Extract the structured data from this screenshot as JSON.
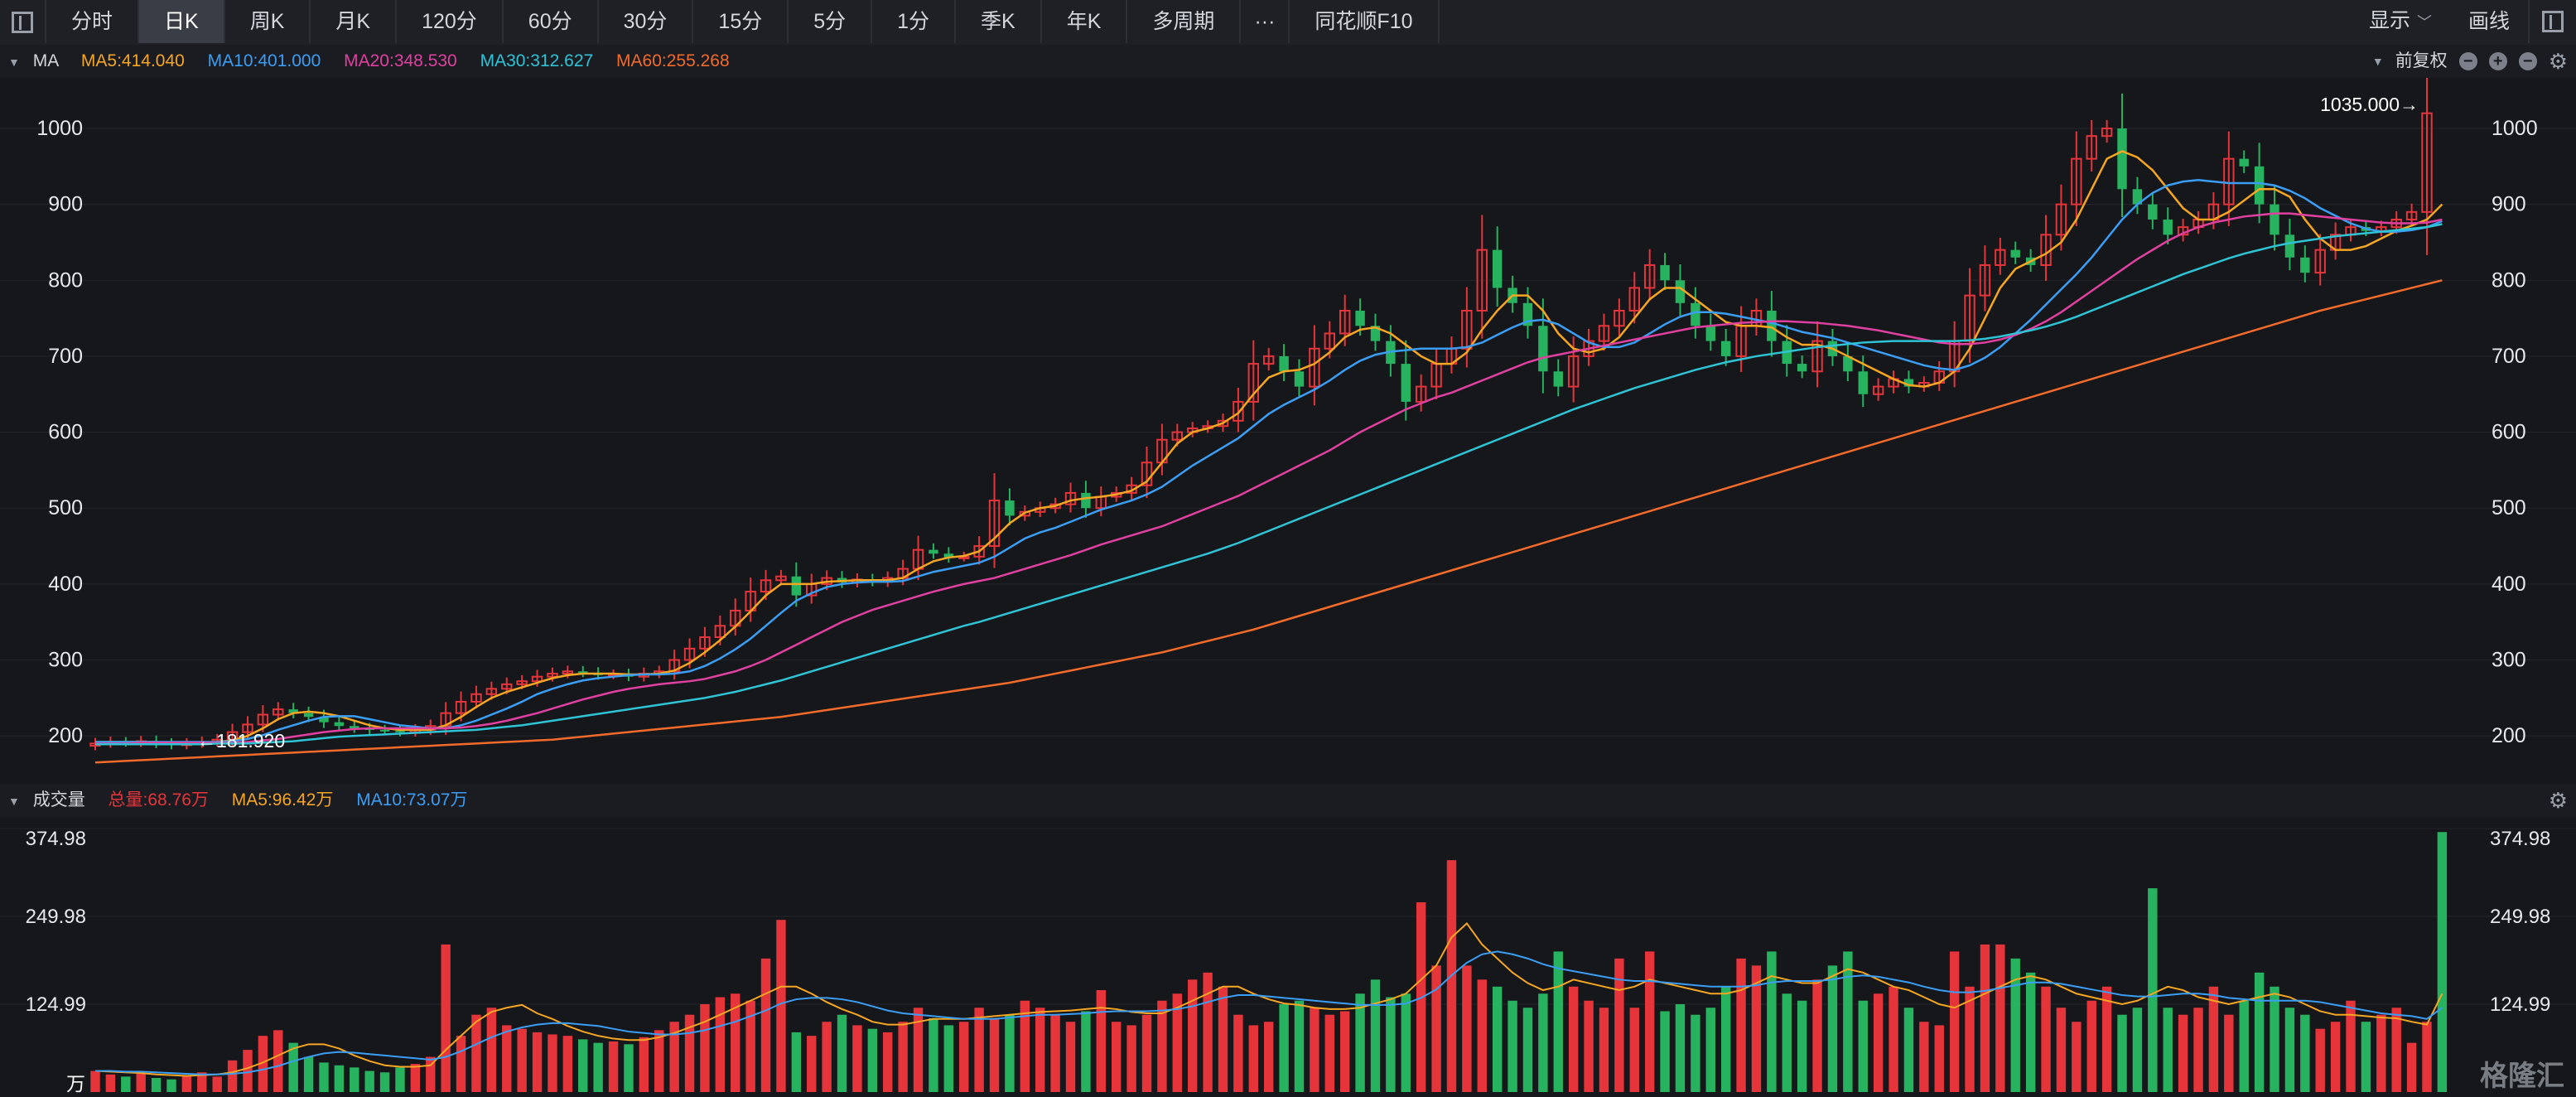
{
  "toolbar": {
    "tabs": [
      "分时",
      "日K",
      "周K",
      "月K",
      "120分",
      "60分",
      "30分",
      "15分",
      "5分",
      "1分",
      "季K",
      "年K",
      "多周期"
    ],
    "more": "···",
    "f10": "同花顺F10",
    "display": "显示",
    "draw": "画线"
  },
  "price_panel": {
    "label": "MA",
    "ma": [
      {
        "text": "MA5:414.040",
        "color": "#f5a623"
      },
      {
        "text": "MA10:401.000",
        "color": "#3b9ef5"
      },
      {
        "text": "MA20:348.530",
        "color": "#e040a0"
      },
      {
        "text": "MA30:312.627",
        "color": "#2ec4d6"
      },
      {
        "text": "MA60:255.268",
        "color": "#f26b2a"
      }
    ],
    "adjust": "前复权",
    "high_label": "1035.000→",
    "low_label": "←181.920"
  },
  "volume_panel": {
    "label": "成交量",
    "items": [
      {
        "text": "总量:68.76万",
        "color": "#e5353b"
      },
      {
        "text": "MA5:96.42万",
        "color": "#f5a623"
      },
      {
        "text": "MA10:73.07万",
        "color": "#3b9ef5"
      }
    ],
    "unit": "万"
  },
  "watermark": "格隆汇",
  "colors": {
    "up": "#e5353b",
    "down": "#27b25f",
    "bg": "#16171b"
  },
  "chart_data": [
    {
      "type": "candlestick",
      "y_ticks": [
        200,
        300,
        400,
        500,
        600,
        700,
        800,
        900,
        1000
      ],
      "ylim": [
        150,
        1060
      ],
      "close": [
        190,
        192,
        191,
        193,
        190,
        188,
        190,
        192,
        195,
        205,
        215,
        228,
        235,
        230,
        225,
        218,
        213,
        210,
        208,
        207,
        205,
        208,
        213,
        230,
        245,
        255,
        262,
        268,
        272,
        278,
        282,
        285,
        283,
        280,
        281,
        278,
        282,
        285,
        300,
        315,
        330,
        345,
        365,
        390,
        405,
        410,
        385,
        400,
        408,
        402,
        406,
        403,
        408,
        420,
        445,
        440,
        435,
        436,
        450,
        510,
        490,
        495,
        500,
        505,
        520,
        500,
        515,
        520,
        530,
        560,
        590,
        600,
        605,
        608,
        615,
        640,
        690,
        700,
        680,
        660,
        710,
        730,
        760,
        740,
        720,
        690,
        640,
        660,
        690,
        710,
        760,
        840,
        790,
        770,
        740,
        680,
        660,
        700,
        720,
        740,
        760,
        790,
        820,
        800,
        770,
        740,
        720,
        700,
        740,
        760,
        720,
        690,
        680,
        720,
        700,
        680,
        650,
        660,
        670,
        660,
        665,
        680,
        720,
        780,
        820,
        840,
        830,
        820,
        860,
        900,
        960,
        990,
        1000,
        920,
        900,
        880,
        860,
        870,
        880,
        900,
        960,
        950,
        900,
        860,
        830,
        810,
        840,
        860,
        870,
        865,
        870,
        880,
        890,
        1020
      ],
      "ma5": [
        192,
        192,
        192,
        192,
        192,
        191,
        191,
        191,
        192,
        194,
        200,
        210,
        222,
        230,
        232,
        230,
        226,
        220,
        214,
        210,
        208,
        208,
        208,
        214,
        225,
        238,
        250,
        258,
        264,
        270,
        276,
        280,
        282,
        282,
        282,
        281,
        281,
        282,
        286,
        296,
        310,
        326,
        344,
        364,
        385,
        400,
        400,
        400,
        403,
        404,
        405,
        405,
        405,
        408,
        420,
        430,
        435,
        437,
        443,
        460,
        480,
        494,
        500,
        503,
        510,
        513,
        515,
        518,
        523,
        535,
        560,
        585,
        600,
        605,
        612,
        625,
        650,
        672,
        680,
        682,
        690,
        705,
        725,
        735,
        738,
        730,
        715,
        700,
        690,
        690,
        705,
        735,
        760,
        780,
        780,
        760,
        730,
        710,
        705,
        710,
        725,
        750,
        775,
        790,
        790,
        775,
        760,
        745,
        740,
        740,
        738,
        725,
        715,
        715,
        710,
        700,
        690,
        680,
        670,
        662,
        660,
        665,
        680,
        710,
        750,
        790,
        815,
        825,
        835,
        850,
        880,
        920,
        960,
        970,
        962,
        945,
        920,
        895,
        880,
        880,
        890,
        905,
        920,
        920,
        910,
        880,
        855,
        840,
        840,
        845,
        855,
        865,
        872,
        880,
        900
      ],
      "ma10": [
        192,
        192,
        192,
        192,
        192,
        192,
        192,
        192,
        192,
        193,
        196,
        201,
        208,
        214,
        220,
        225,
        226,
        226,
        222,
        218,
        214,
        212,
        210,
        210,
        214,
        220,
        228,
        236,
        245,
        255,
        262,
        268,
        273,
        276,
        278,
        280,
        281,
        281,
        282,
        285,
        292,
        302,
        314,
        328,
        345,
        362,
        378,
        388,
        396,
        400,
        402,
        403,
        403,
        404,
        410,
        416,
        420,
        424,
        428,
        436,
        448,
        460,
        468,
        474,
        482,
        490,
        498,
        504,
        510,
        518,
        528,
        542,
        556,
        568,
        580,
        592,
        608,
        624,
        636,
        646,
        656,
        668,
        682,
        694,
        702,
        706,
        708,
        710,
        710,
        710,
        712,
        718,
        728,
        738,
        746,
        748,
        742,
        730,
        718,
        712,
        712,
        718,
        730,
        742,
        752,
        758,
        758,
        756,
        752,
        748,
        744,
        738,
        732,
        728,
        724,
        718,
        712,
        706,
        700,
        694,
        688,
        684,
        682,
        688,
        698,
        712,
        730,
        748,
        768,
        788,
        808,
        830,
        855,
        880,
        900,
        915,
        925,
        930,
        932,
        930,
        928,
        928,
        928,
        925,
        918,
        908,
        895,
        885,
        875,
        868,
        864,
        864,
        866,
        870,
        878
      ],
      "ma20": [
        190,
        190,
        190,
        191,
        191,
        191,
        191,
        191,
        191,
        191,
        192,
        194,
        196,
        199,
        202,
        205,
        207,
        209,
        210,
        210,
        210,
        210,
        210,
        210,
        211,
        213,
        216,
        220,
        225,
        230,
        236,
        242,
        248,
        253,
        258,
        262,
        265,
        268,
        270,
        272,
        275,
        280,
        285,
        292,
        300,
        310,
        320,
        330,
        340,
        350,
        358,
        366,
        372,
        378,
        384,
        390,
        395,
        400,
        404,
        408,
        414,
        420,
        426,
        432,
        438,
        445,
        452,
        458,
        464,
        470,
        476,
        484,
        492,
        500,
        508,
        516,
        526,
        536,
        546,
        556,
        566,
        576,
        588,
        600,
        610,
        620,
        630,
        638,
        646,
        652,
        660,
        668,
        676,
        684,
        692,
        698,
        702,
        706,
        710,
        714,
        718,
        722,
        726,
        730,
        734,
        738,
        740,
        742,
        744,
        745,
        746,
        746,
        745,
        744,
        742,
        740,
        737,
        734,
        730,
        726,
        722,
        718,
        716,
        716,
        718,
        722,
        728,
        736,
        746,
        758,
        772,
        786,
        800,
        814,
        828,
        840,
        852,
        862,
        870,
        876,
        880,
        884,
        886,
        888,
        888,
        886,
        884,
        882,
        880,
        878,
        876,
        875,
        875,
        876,
        880
      ],
      "ma30": [
        189,
        189,
        189,
        189,
        189,
        189,
        189,
        189,
        190,
        190,
        190,
        191,
        192,
        193,
        195,
        197,
        199,
        200,
        201,
        202,
        203,
        204,
        205,
        206,
        207,
        208,
        210,
        212,
        214,
        217,
        220,
        223,
        226,
        229,
        232,
        235,
        238,
        241,
        244,
        247,
        250,
        254,
        258,
        263,
        268,
        273,
        279,
        285,
        291,
        297,
        303,
        309,
        315,
        321,
        327,
        333,
        339,
        345,
        350,
        356,
        362,
        368,
        374,
        380,
        386,
        392,
        398,
        404,
        410,
        416,
        422,
        428,
        434,
        440,
        447,
        454,
        462,
        470,
        478,
        486,
        494,
        502,
        510,
        518,
        526,
        534,
        542,
        550,
        558,
        566,
        574,
        582,
        590,
        598,
        606,
        614,
        622,
        630,
        637,
        644,
        651,
        658,
        664,
        670,
        676,
        682,
        687,
        692,
        696,
        700,
        703,
        706,
        709,
        712,
        714,
        716,
        718,
        719,
        720,
        720,
        720,
        720,
        720,
        721,
        723,
        726,
        730,
        734,
        739,
        745,
        752,
        760,
        768,
        776,
        784,
        792,
        800,
        808,
        815,
        822,
        829,
        835,
        840,
        845,
        849,
        852,
        855,
        858,
        860,
        862,
        864,
        866,
        868,
        870,
        874
      ],
      "ma60": [
        165,
        166,
        167,
        168,
        169,
        170,
        171,
        172,
        173,
        174,
        175,
        176,
        177,
        178,
        179,
        180,
        181,
        182,
        183,
        184,
        185,
        186,
        187,
        188,
        189,
        190,
        191,
        192,
        193,
        194,
        195,
        197,
        199,
        201,
        203,
        205,
        207,
        209,
        211,
        213,
        215,
        217,
        219,
        221,
        223,
        225,
        228,
        231,
        234,
        237,
        240,
        243,
        246,
        249,
        252,
        255,
        258,
        261,
        264,
        267,
        270,
        274,
        278,
        282,
        286,
        290,
        294,
        298,
        302,
        306,
        310,
        315,
        320,
        325,
        330,
        335,
        340,
        346,
        352,
        358,
        364,
        370,
        376,
        382,
        388,
        394,
        400,
        406,
        412,
        418,
        424,
        430,
        436,
        442,
        448,
        454,
        460,
        466,
        472,
        478,
        484,
        490,
        496,
        502,
        508,
        514,
        520,
        526,
        532,
        538,
        544,
        550,
        556,
        562,
        568,
        574,
        580,
        586,
        592,
        598,
        604,
        610,
        616,
        622,
        628,
        634,
        640,
        646,
        652,
        658,
        664,
        670,
        676,
        682,
        688,
        694,
        700,
        706,
        712,
        718,
        724,
        730,
        736,
        742,
        748,
        754,
        760,
        765,
        770,
        775,
        780,
        785,
        790,
        795,
        800
      ]
    },
    {
      "type": "bar",
      "y_ticks": [
        124.99,
        249.98,
        374.98
      ],
      "ylim": [
        0,
        374.98
      ],
      "values": [
        30,
        25,
        22,
        26,
        20,
        18,
        24,
        28,
        22,
        45,
        60,
        80,
        88,
        70,
        50,
        42,
        38,
        35,
        30,
        28,
        35,
        40,
        50,
        210,
        80,
        110,
        120,
        95,
        90,
        85,
        82,
        80,
        75,
        70,
        72,
        68,
        78,
        88,
        100,
        110,
        125,
        135,
        140,
        130,
        190,
        245,
        85,
        80,
        100,
        110,
        95,
        90,
        85,
        100,
        120,
        105,
        95,
        100,
        120,
        105,
        110,
        130,
        120,
        110,
        100,
        115,
        145,
        100,
        95,
        110,
        130,
        140,
        160,
        170,
        150,
        110,
        95,
        100,
        125,
        130,
        120,
        110,
        115,
        140,
        160,
        135,
        140,
        270,
        180,
        330,
        180,
        160,
        150,
        130,
        120,
        140,
        200,
        150,
        130,
        120,
        190,
        120,
        200,
        115,
        125,
        110,
        120,
        150,
        190,
        180,
        200,
        140,
        130,
        160,
        180,
        200,
        130,
        140,
        150,
        120,
        100,
        95,
        200,
        150,
        210,
        210,
        190,
        170,
        150,
        120,
        100,
        130,
        150,
        110,
        120,
        290,
        120,
        110,
        120,
        150,
        110,
        130,
        170,
        150,
        120,
        110,
        90,
        100,
        130,
        100,
        110,
        120,
        70,
        100,
        370
      ],
      "ma5": [
        30,
        29,
        28,
        27,
        25,
        24,
        23,
        24,
        25,
        28,
        34,
        42,
        52,
        62,
        68,
        68,
        62,
        52,
        44,
        38,
        36,
        36,
        38,
        60,
        80,
        100,
        114,
        120,
        124,
        112,
        104,
        94,
        86,
        80,
        76,
        74,
        74,
        78,
        84,
        92,
        100,
        110,
        120,
        130,
        140,
        150,
        150,
        140,
        128,
        118,
        110,
        100,
        96,
        96,
        100,
        104,
        104,
        104,
        106,
        108,
        110,
        112,
        114,
        115,
        116,
        118,
        120,
        118,
        114,
        112,
        112,
        120,
        130,
        140,
        150,
        150,
        140,
        132,
        126,
        124,
        120,
        118,
        118,
        120,
        126,
        132,
        140,
        160,
        180,
        220,
        240,
        210,
        190,
        170,
        155,
        145,
        150,
        160,
        155,
        150,
        145,
        150,
        160,
        155,
        150,
        145,
        140,
        140,
        145,
        155,
        165,
        160,
        155,
        155,
        165,
        175,
        170,
        160,
        150,
        145,
        135,
        125,
        120,
        130,
        140,
        150,
        160,
        165,
        160,
        150,
        140,
        135,
        130,
        125,
        130,
        140,
        150,
        145,
        135,
        130,
        125,
        130,
        135,
        140,
        135,
        125,
        115,
        110,
        110,
        108,
        106,
        105,
        100,
        96,
        140
      ],
      "ma10": [
        30,
        30,
        29,
        29,
        28,
        27,
        26,
        25,
        25,
        26,
        28,
        32,
        37,
        44,
        50,
        55,
        57,
        56,
        54,
        52,
        50,
        48,
        46,
        50,
        58,
        68,
        78,
        86,
        92,
        96,
        98,
        98,
        96,
        94,
        90,
        86,
        84,
        82,
        82,
        84,
        88,
        94,
        100,
        108,
        116,
        126,
        132,
        134,
        134,
        132,
        128,
        122,
        116,
        112,
        110,
        108,
        106,
        104,
        104,
        104,
        106,
        108,
        110,
        110,
        111,
        112,
        114,
        115,
        115,
        115,
        116,
        118,
        122,
        128,
        134,
        138,
        138,
        136,
        134,
        132,
        130,
        128,
        126,
        124,
        124,
        124,
        126,
        134,
        146,
        166,
        184,
        196,
        200,
        196,
        190,
        182,
        176,
        172,
        168,
        164,
        160,
        158,
        158,
        156,
        154,
        152,
        150,
        150,
        150,
        152,
        156,
        158,
        158,
        158,
        160,
        164,
        166,
        164,
        160,
        156,
        150,
        145,
        142,
        142,
        144,
        148,
        152,
        156,
        156,
        154,
        150,
        146,
        142,
        138,
        136,
        136,
        138,
        140,
        140,
        138,
        134,
        132,
        130,
        130,
        130,
        130,
        128,
        124,
        120,
        116,
        112,
        110,
        108,
        104,
        120
      ]
    }
  ]
}
